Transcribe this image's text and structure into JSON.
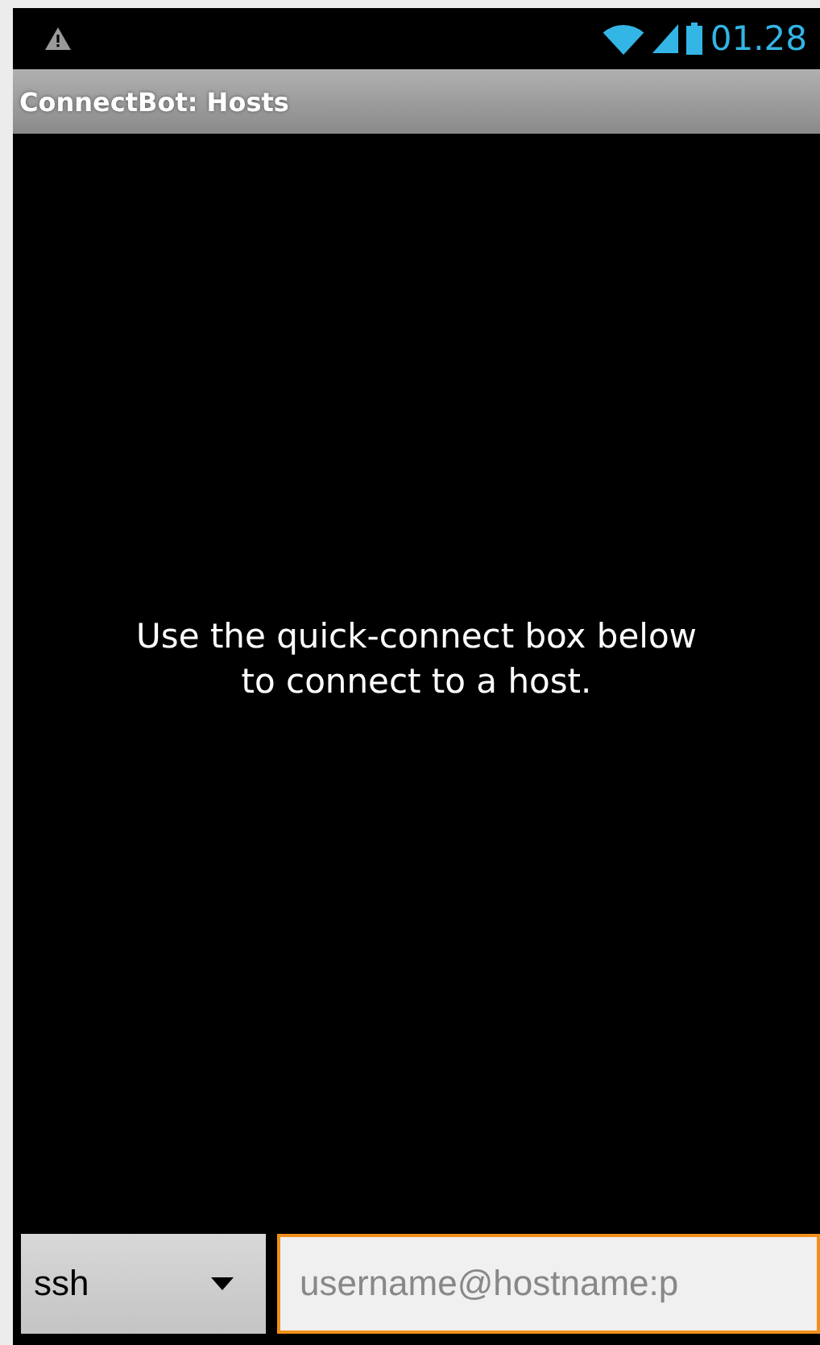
{
  "status_bar": {
    "time": "01.28"
  },
  "window": {
    "title": "ConnectBot: Hosts"
  },
  "message": "Use the quick-connect box below to connect to a host.",
  "quick_connect": {
    "protocol": "ssh",
    "placeholder": "username@hostname:p",
    "focused": true
  }
}
